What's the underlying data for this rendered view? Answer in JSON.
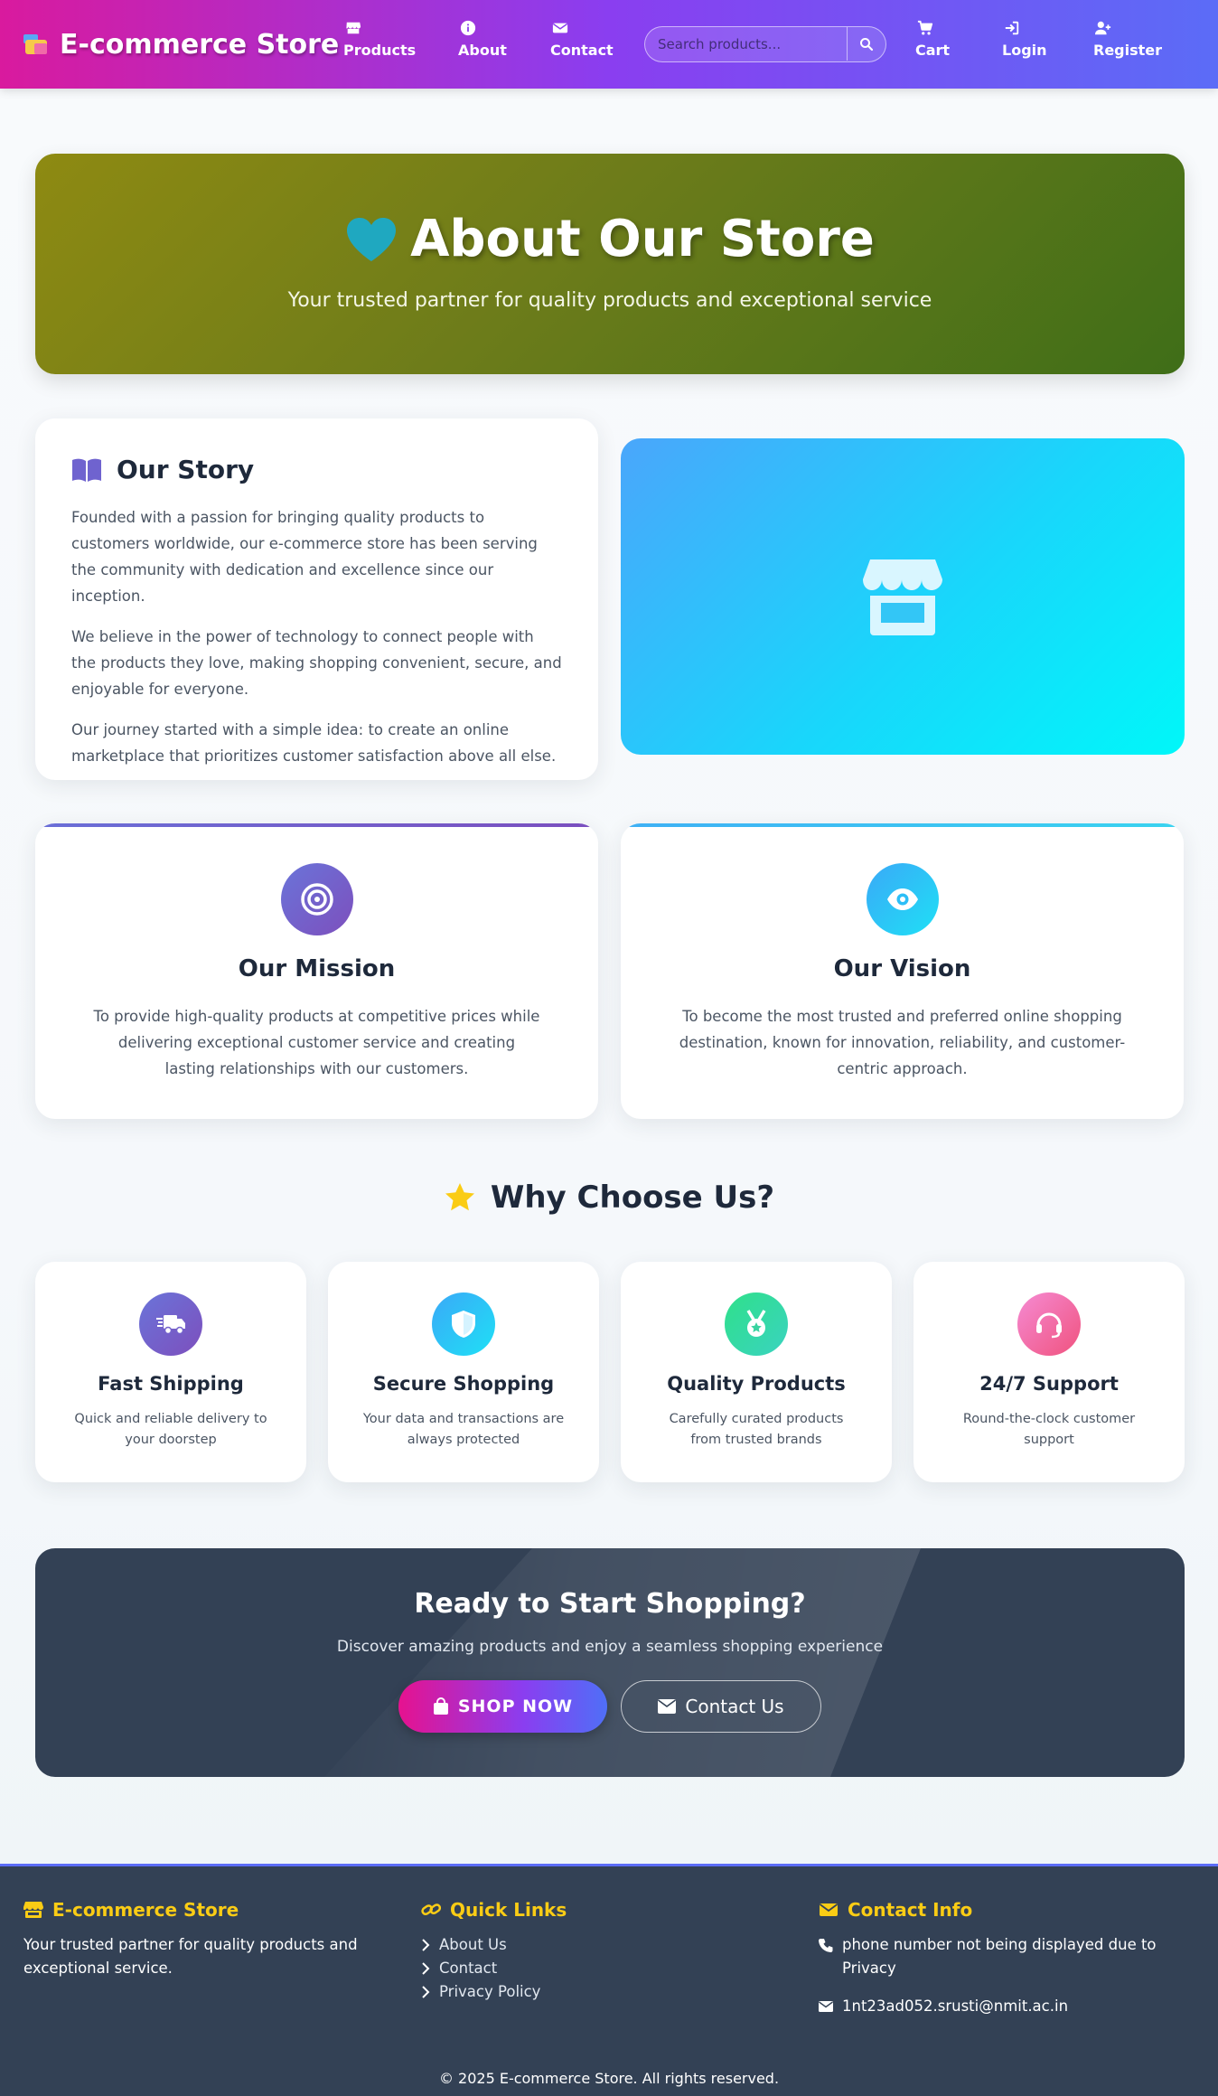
{
  "navbar": {
    "brand": "E-commerce Store",
    "items": [
      {
        "label": "Products",
        "icon": "store-icon"
      },
      {
        "label": "About",
        "icon": "info-icon"
      },
      {
        "label": "Contact",
        "icon": "envelope-icon"
      },
      {
        "label": "Cart",
        "icon": "cart-icon"
      },
      {
        "label": "Login",
        "icon": "sign-in-icon"
      },
      {
        "label": "Register",
        "icon": "user-plus-icon"
      }
    ],
    "search_placeholder": "Search products..."
  },
  "hero": {
    "title": "About Our Store",
    "subtitle": "Your trusted partner for quality products and exceptional service",
    "icon": "heart-icon"
  },
  "story": {
    "title": "Our Story",
    "paragraphs": [
      "Founded with a passion for bringing quality products to customers worldwide, our e-commerce store has been serving the community with dedication and excellence since our inception.",
      "We believe in the power of technology to connect people with the products they love, making shopping convenient, secure, and enjoyable for everyone.",
      "Our journey started with a simple idea: to create an online marketplace that prioritizes customer satisfaction above all else."
    ]
  },
  "mission": {
    "title": "Our Mission",
    "text": "To provide high-quality products at competitive prices while delivering exceptional customer service and creating lasting relationships with our customers."
  },
  "vision": {
    "title": "Our Vision",
    "text": "To become the most trusted and preferred online shopping destination, known for innovation, reliability, and customer-centric approach."
  },
  "why": {
    "title": "Why Choose Us?",
    "features": [
      {
        "title": "Fast Shipping",
        "text": "Quick and reliable delivery to your doorstep"
      },
      {
        "title": "Secure Shopping",
        "text": "Your data and transactions are always protected"
      },
      {
        "title": "Quality Products",
        "text": "Carefully curated products from trusted brands"
      },
      {
        "title": "24/7 Support",
        "text": "Round-the-clock customer support"
      }
    ]
  },
  "cta": {
    "title": "Ready to Start Shopping?",
    "subtitle": "Discover amazing products and enjoy a seamless shopping experience",
    "shop_label": "SHOP NOW",
    "contact_label": "Contact Us"
  },
  "footer": {
    "brand": "E-commerce Store",
    "brand_desc": "Your trusted partner for quality products and exceptional service.",
    "quick_links_title": "Quick Links",
    "links": [
      "About Us",
      "Contact",
      "Privacy Policy"
    ],
    "contact_title": "Contact Info",
    "phone": "phone number not being displayed due to Privacy",
    "email": "1nt23ad052.srusti@nmit.ac.in",
    "copyright": "© 2025 E-commerce Store. All rights reserved."
  },
  "colors": {
    "accent_yellow": "#facc15",
    "nav_gradient_start": "#d91a9e",
    "nav_gradient_end": "#5b6cf7",
    "dark_slate": "#334155"
  }
}
